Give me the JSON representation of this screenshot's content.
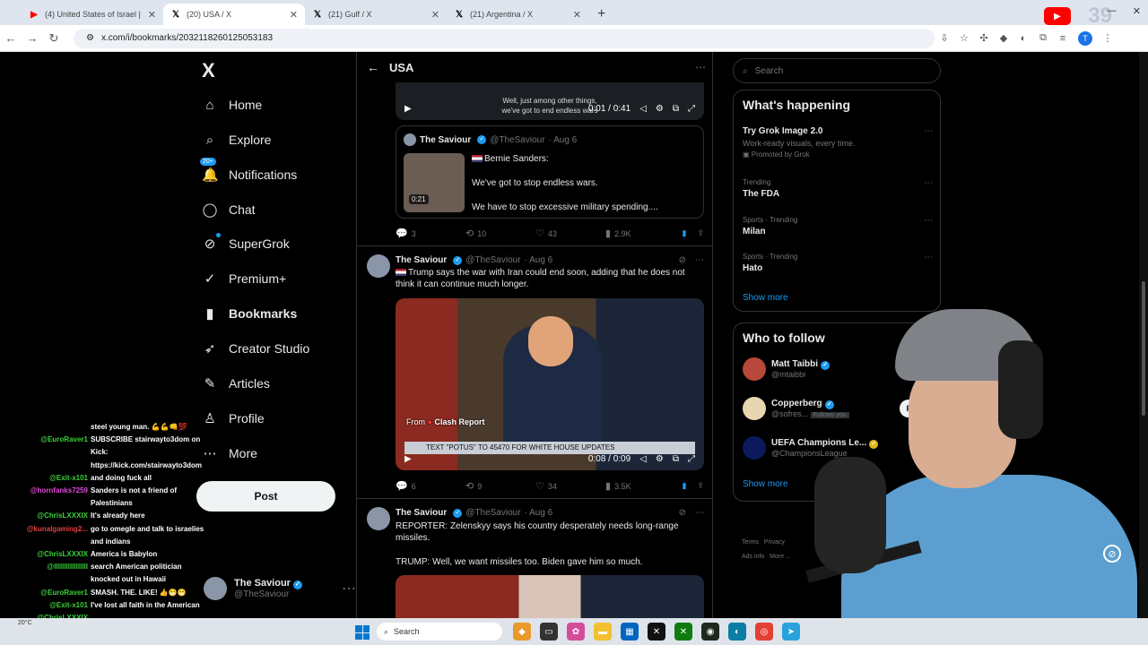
{
  "browser": {
    "tabs": [
      {
        "title": "(4) United States of Israel | New",
        "icon": "youtube-icon",
        "active": false
      },
      {
        "title": "(20) USA / X",
        "icon": "x-icon",
        "active": true
      },
      {
        "title": "(21) Gulf / X",
        "icon": "x-icon",
        "active": false
      },
      {
        "title": "(21) Argentina / X",
        "icon": "x-icon",
        "active": false
      }
    ],
    "url": "x.com/i/bookmarks/2032118260125053183",
    "overlay_number": "39"
  },
  "sidebar": {
    "logo": "X",
    "items": [
      {
        "label": "Home",
        "icon": "home-icon",
        "glyph": "⌂"
      },
      {
        "label": "Explore",
        "icon": "search-icon",
        "glyph": "⌕"
      },
      {
        "label": "Notifications",
        "icon": "bell-icon",
        "glyph": "🔔",
        "badge": "20+"
      },
      {
        "label": "Chat",
        "icon": "chat-icon",
        "glyph": "◯"
      },
      {
        "label": "SuperGrok",
        "icon": "grok-icon",
        "glyph": "⊘"
      },
      {
        "label": "Premium+",
        "icon": "premium-icon",
        "glyph": "✓"
      },
      {
        "label": "Bookmarks",
        "icon": "bookmark-icon",
        "glyph": "▮"
      },
      {
        "label": "Creator Studio",
        "icon": "rocket-icon",
        "glyph": "➶"
      },
      {
        "label": "Articles",
        "icon": "article-icon",
        "glyph": "✎"
      },
      {
        "label": "Profile",
        "icon": "profile-icon",
        "glyph": "♙"
      },
      {
        "label": "More",
        "icon": "more-icon",
        "glyph": "⋯"
      }
    ],
    "post_label": "Post",
    "account": {
      "name": "The Saviour",
      "handle": "@TheSaviour"
    }
  },
  "main": {
    "title": "USA",
    "video1": {
      "time": "0:01 / 0:41",
      "caption1": "Well, just among other things,",
      "caption2": "we've got to end endless wars"
    },
    "quote": {
      "name": "The Saviour",
      "handle": "@TheSaviour",
      "date": "· Aug 6",
      "duration": "0:21",
      "line1": "Bernie Sanders:",
      "line2": "We've got to stop endless wars.",
      "line3": "We have to stop excessive military spending...."
    },
    "tweet1_stats": {
      "replies": "3",
      "reposts": "10",
      "likes": "43",
      "views": "2.9K"
    },
    "tweet2": {
      "name": "The Saviour",
      "handle": "@TheSaviour",
      "date": "· Aug 6",
      "text": "Trump says the war with Iran could end soon, adding that he does not think it can continue much longer.",
      "source": "From",
      "source_name": "Clash Report",
      "banner": "TEXT \"POTUS\" TO 45470 FOR WHITE HOUSE UPDATES",
      "time": "0:08 / 0:09",
      "stats": {
        "replies": "6",
        "reposts": "9",
        "likes": "34",
        "views": "3.5K"
      }
    },
    "tweet3": {
      "name": "The Saviour",
      "handle": "@TheSaviour",
      "date": "· Aug 6",
      "text1": "REPORTER: Zelenskyy says his country desperately needs long-range missiles.",
      "text2": "TRUMP: Well, we want missiles too. Biden gave him so much."
    }
  },
  "right": {
    "search_placeholder": "Search",
    "happening_title": "What's happening",
    "trends": [
      {
        "meta": "",
        "title": "Try Grok Image 2.0",
        "sub": "Work-ready visuals, every time.",
        "promo": "Promoted by Grok"
      },
      {
        "meta": "Trending",
        "title": "The FDA"
      },
      {
        "meta": "Sports · Trending",
        "title": "Milan"
      },
      {
        "meta": "Sports · Trending",
        "title": "Hato"
      }
    ],
    "show_more": "Show more",
    "follow_title": "Who to follow",
    "follows": [
      {
        "name": "Matt Taibbi",
        "handle": "@mtaibbi",
        "button": "F"
      },
      {
        "name": "Copperberg",
        "handle": "@sofres...",
        "extra": "Follows you",
        "button": "Follo"
      },
      {
        "name": "UEFA Champions Le...",
        "handle": "@ChampionsLeague",
        "button": ""
      }
    ],
    "show_more2": "Show more",
    "footer": [
      "Terms",
      "Privacy",
      "Ads info",
      "More ..."
    ]
  },
  "chat": [
    {
      "user": "",
      "msg": "steel young man. 💪💪👊💯",
      "color": "#ffffff"
    },
    {
      "user": "@EuroRaver1",
      "msg": "SUBSCRIBE stairwayto3dom on",
      "color": "#3ad13a"
    },
    {
      "user": "",
      "msg": "Kick:",
      "color": "#ffffff"
    },
    {
      "user": "",
      "msg": "https://kick.com/stairwayto3dom",
      "color": "#ffffff"
    },
    {
      "user": "@Exit-x101",
      "msg": "and doing fuck all",
      "color": "#3ad13a"
    },
    {
      "user": "@hornfanks7259",
      "msg": "Sanders is not a friend of",
      "color": "#e04ad9"
    },
    {
      "user": "",
      "msg": "Palestinians",
      "color": "#ffffff"
    },
    {
      "user": "@ChrisLXXXIX",
      "msg": "It's already here",
      "color": "#3ad13a"
    },
    {
      "user": "@kunalgaming2...",
      "msg": "go to omegle and talk to israelies",
      "color": "#e04040"
    },
    {
      "user": "",
      "msg": "and indians",
      "color": "#ffffff"
    },
    {
      "user": "@ChrisLXXXIX",
      "msg": "America is Babylon",
      "color": "#3ad13a"
    },
    {
      "user": "@lllllllllllllllll",
      "msg": "search American politician",
      "color": "#3ad13a"
    },
    {
      "user": "",
      "msg": "knocked out in Hawaii",
      "color": "#ffffff"
    },
    {
      "user": "@EuroRaver1",
      "msg": "SMASH. THE. LIKE! 👍😁😁",
      "color": "#3ad13a"
    },
    {
      "user": "@Exit-x101",
      "msg": "I've lost all faith in the American",
      "color": "#3ad13a"
    },
    {
      "user": "@ChrisLXXXIX",
      "msg": "",
      "color": "#3ad13a"
    }
  ],
  "taskbar": {
    "weather": "20°C",
    "search": "Search"
  }
}
